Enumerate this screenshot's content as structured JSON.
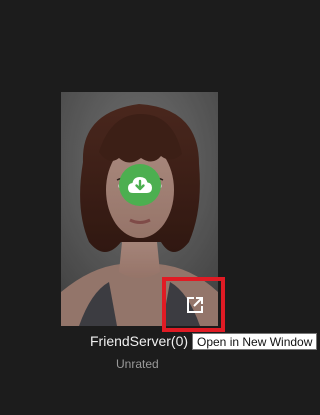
{
  "item": {
    "title": "FriendServer(0)",
    "rating": "Unrated",
    "thumbnail_subject": "portrait of a woman with auburn bob haircut"
  },
  "actions": {
    "download_icon": "cloud-download-icon",
    "open_icon": "open-in-new-window-icon"
  },
  "tooltip": {
    "text": "Open in New Window"
  },
  "colors": {
    "background": "#1c1c1c",
    "download_button": "#4caf50",
    "highlight": "#e01b24"
  }
}
